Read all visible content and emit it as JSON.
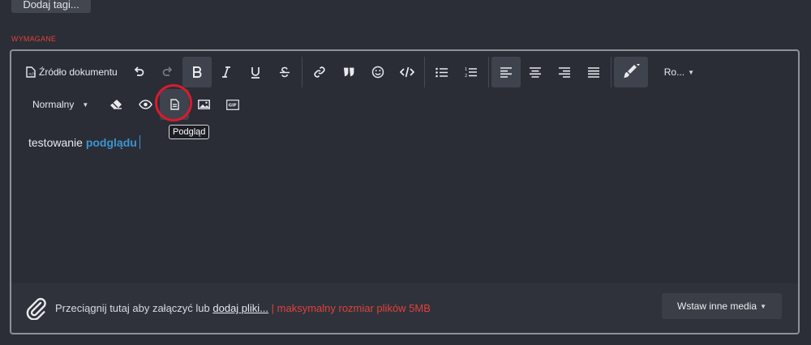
{
  "tags_button": {
    "label": "Dodaj tagi..."
  },
  "required_label": "WYMAGANE",
  "toolbar": {
    "source_label": "Źródło dokumentu",
    "format_dropdown": "Normalny",
    "font_dropdown": "Ro...",
    "tooltip": "Podgląd"
  },
  "content": {
    "plain": "testowanie ",
    "bold": "podglądu"
  },
  "attachments": {
    "prefix": "Przeciągnij tutaj aby załączyć lub ",
    "link": "dodaj pliki...",
    "separator": " | ",
    "limit": "maksymalny rozmiar plików 5MB",
    "media_button": "Wstaw inne media"
  },
  "colors": {
    "background": "#2b2e37",
    "accent_link": "#3e94d1",
    "required": "#e0413a",
    "highlight": "#d81b2e"
  }
}
